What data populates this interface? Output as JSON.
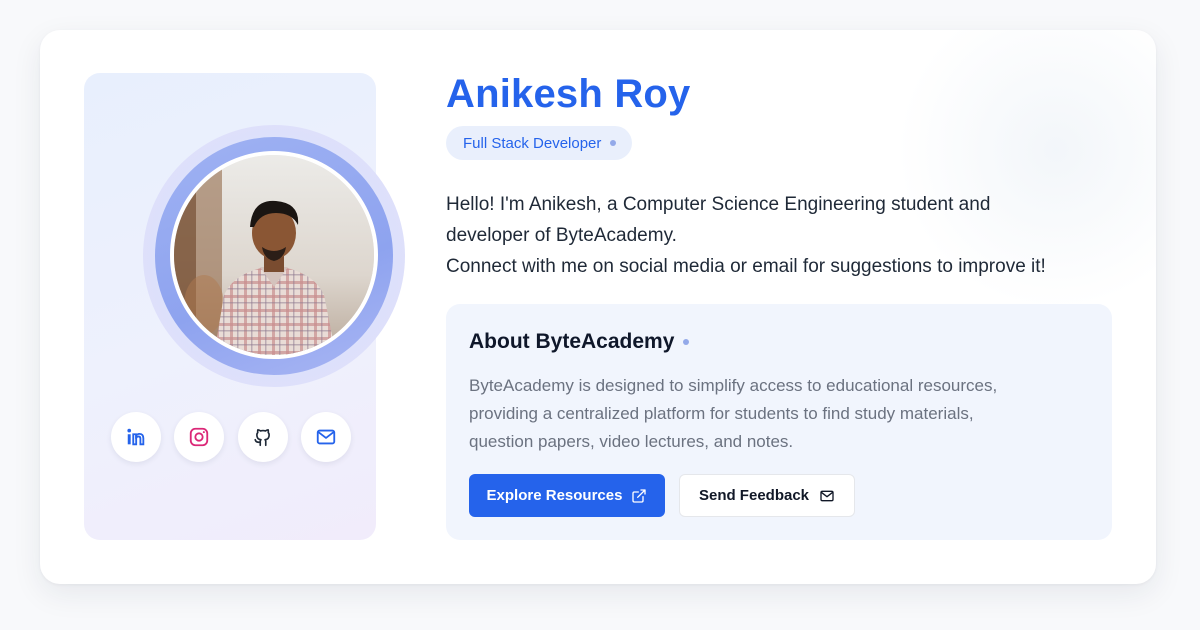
{
  "profile": {
    "name": "Anikesh Roy",
    "role": "Full Stack Developer",
    "intro_lines": [
      "Hello! I'm Anikesh, a Computer Science Engineering student and",
      "developer of ByteAcademy.",
      "Connect with me on social media or email for suggestions to improve it!"
    ]
  },
  "socials": [
    {
      "icon": "linkedin-icon",
      "color": "#2563eb"
    },
    {
      "icon": "instagram-icon",
      "color": "#db2777"
    },
    {
      "icon": "github-icon",
      "color": "#1f2937"
    },
    {
      "icon": "mail-icon",
      "color": "#2563eb"
    }
  ],
  "about": {
    "title": "About ByteAcademy",
    "text_lines": [
      "ByteAcademy is designed to simplify access to educational resources,",
      "providing a centralized platform for students to find study materials,",
      "question papers, video lectures, and notes."
    ],
    "primary_button": {
      "label": "Explore Resources",
      "icon": "external-link-icon"
    },
    "secondary_button": {
      "label": "Send Feedback",
      "icon": "mail-icon"
    }
  },
  "colors": {
    "accent": "#2563eb",
    "pill_bg": "#e9effc",
    "about_bg": "#f1f5fd",
    "body_text": "#1f2937",
    "muted_text": "#6b7280"
  }
}
